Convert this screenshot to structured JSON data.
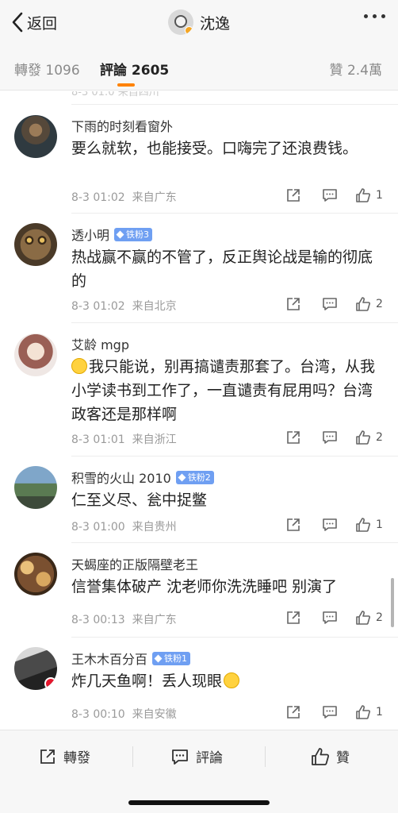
{
  "header": {
    "back_label": "返回",
    "title": "沈逸"
  },
  "tabs": {
    "repost_label": "轉發",
    "repost_count": "1096",
    "comments_label": "評論",
    "comments_count": "2605",
    "likes_label": "贊",
    "likes_count": "2.4萬"
  },
  "prev_remnant": "8-3 01:0 来自四川",
  "comments": [
    {
      "name": "下雨的时刻看窗外",
      "fan_badge": "",
      "text": "要么就软，也能接受。口嗨完了还浪费钱。",
      "time": "8-3 01:02",
      "location": "来自广东",
      "likes": "1"
    },
    {
      "name": "透小明",
      "fan_badge": "铁粉3",
      "text": "热战赢不赢的不管了，反正舆论战是输的彻底的",
      "time": "8-3 01:02",
      "location": "来自北京",
      "likes": "2"
    },
    {
      "name": "艾龄 mgp",
      "fan_badge": "",
      "text": "我只能说，别再搞谴责那套了。台湾，从我小学读书到工作了，一直谴责有屁用吗？台湾政客还是那样啊",
      "time": "8-3 01:01",
      "location": "来自浙江",
      "likes": "2"
    },
    {
      "name": "积雪的火山 2010",
      "fan_badge": "铁粉2",
      "text": "仁至义尽、瓮中捉鳖",
      "time": "8-3 01:00",
      "location": "来自贵州",
      "likes": "1"
    },
    {
      "name": "天蝎座的正版隔壁老王",
      "fan_badge": "",
      "text": "信誉集体破产 沈老师你洗洗睡吧 别演了",
      "time": "8-3 00:13",
      "location": "来自广东",
      "likes": "2"
    },
    {
      "name": "王木木百分百",
      "fan_badge": "铁粉1",
      "text": "炸几天鱼啊！丢人现眼",
      "time": "8-3 00:10",
      "location": "来自安徽",
      "likes": "1"
    }
  ],
  "bottom_bar": {
    "repost_label": "轉發",
    "comment_label": "評論",
    "like_label": "贊"
  },
  "colors": {
    "accent": "#ff8200",
    "fan_badge": "#6f9ff2",
    "verified": "#e6162d"
  },
  "icons": [
    "back-chevron-icon",
    "more-dots-icon",
    "share-icon",
    "reply-icon",
    "like-icon",
    "diamond-icon",
    "face-emoji-icon"
  ]
}
